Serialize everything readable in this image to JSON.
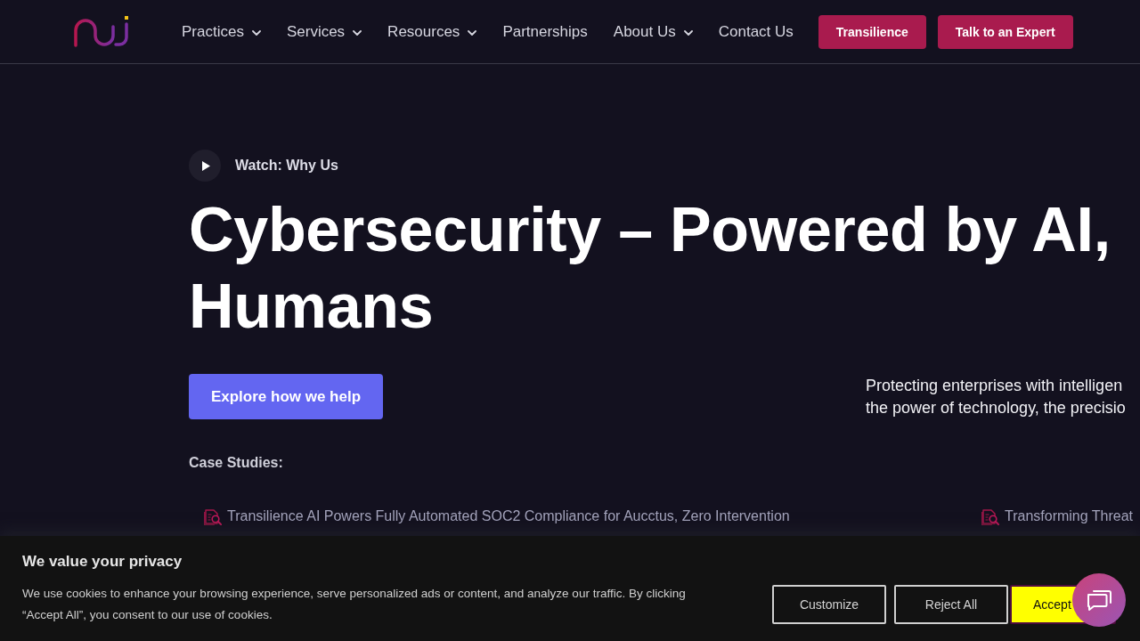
{
  "header": {
    "nav": [
      {
        "label": "Practices",
        "dropdown": true
      },
      {
        "label": "Services",
        "dropdown": true
      },
      {
        "label": "Resources",
        "dropdown": true
      },
      {
        "label": "Partnerships",
        "dropdown": false
      },
      {
        "label": "About Us",
        "dropdown": true
      },
      {
        "label": "Contact Us",
        "dropdown": false
      }
    ],
    "buttons": [
      "Transilience",
      "Talk to an Expert"
    ]
  },
  "hero": {
    "watch_label": "Watch: Why Us",
    "title_lines": [
      "Cybersecurity – Powered by AI,",
      "Humans"
    ],
    "cta": "Explore how we help",
    "description_lines": [
      "Protecting enterprises with intelligen",
      "the power of technology, the precisio"
    ],
    "case_studies_label": "Case Studies:",
    "case_studies": [
      "Transilience AI Powers Fully Automated SOC2 Compliance for Aucctus, Zero Intervention",
      "Transforming Threat"
    ]
  },
  "cookie_banner": {
    "title": "We value your privacy",
    "text": "We use cookies to enhance your browsing experience, serve personalized ads or content, and analyze our traffic. By clicking “Accept All”, you consent to our use of cookies.",
    "buttons": [
      {
        "label": "Customize",
        "kind": "outline"
      },
      {
        "label": "Reject All",
        "kind": "outline"
      },
      {
        "label": "Accept",
        "kind": "primary"
      }
    ]
  }
}
